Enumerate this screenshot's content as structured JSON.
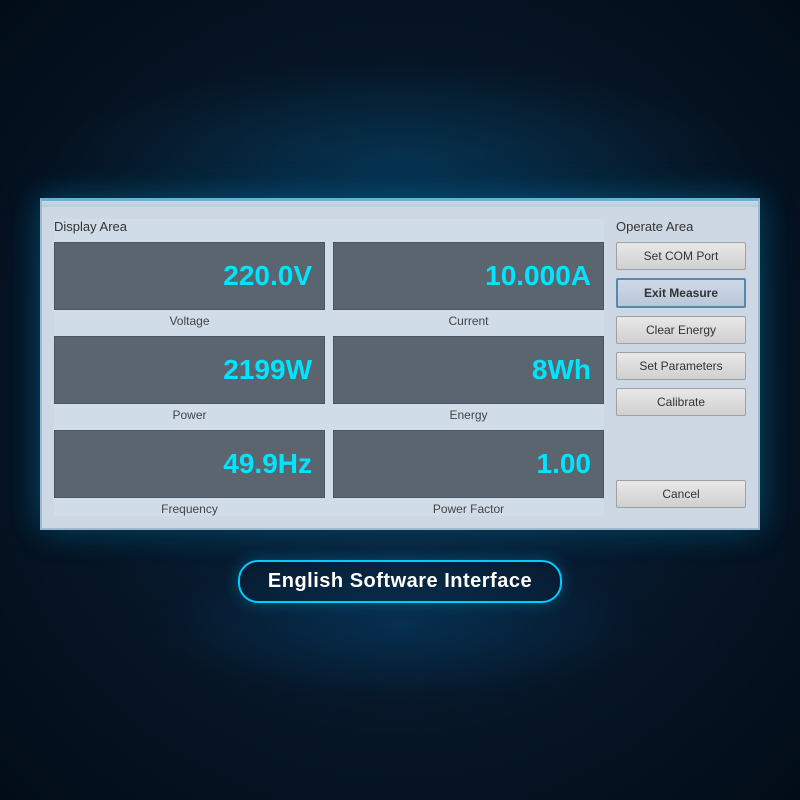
{
  "background": {
    "color": "#0a2a4a"
  },
  "window": {
    "display_area_title": "Display Area",
    "operate_area_title": "Operate Area",
    "meters": [
      {
        "id": "voltage",
        "value": "220.0V",
        "label": "Voltage"
      },
      {
        "id": "current",
        "value": "10.000A",
        "label": "Current"
      },
      {
        "id": "power",
        "value": "2199W",
        "label": "Power"
      },
      {
        "id": "energy",
        "value": "8Wh",
        "label": "Energy"
      },
      {
        "id": "frequency",
        "value": "49.9Hz",
        "label": "Frequency"
      },
      {
        "id": "power-factor",
        "value": "1.00",
        "label": "Power Factor"
      }
    ],
    "buttons": [
      {
        "id": "set-com-port",
        "label": "Set COM Port",
        "active": false
      },
      {
        "id": "exit-measure",
        "label": "Exit Measure",
        "active": true
      },
      {
        "id": "clear-energy",
        "label": "Clear Energy",
        "active": false
      },
      {
        "id": "set-parameters",
        "label": "Set Parameters",
        "active": false
      },
      {
        "id": "calibrate",
        "label": "Calibrate",
        "active": false
      },
      {
        "id": "cancel",
        "label": "Cancel",
        "active": false
      }
    ]
  },
  "bottom_label": "English Software Interface"
}
